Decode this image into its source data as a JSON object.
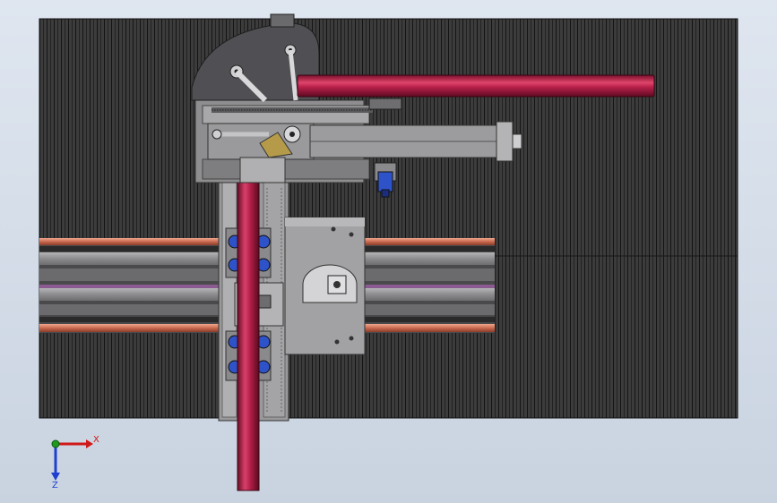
{
  "window": {
    "title": ""
  },
  "colors": {
    "background_top": "#dfe6f0",
    "background_bottom": "#c9d3e0",
    "slat_base": "#3c3c3c",
    "slat_line": "#141414",
    "tube": "#b8204a",
    "tube_highlight": "#ff6f8f",
    "machine_grey": "#8e8e90",
    "rail_copper": "#d27a62",
    "axis_x": "#d01818",
    "axis_y": "#1f9a1f",
    "axis_z": "#1f3fd0",
    "motor_blue": "#2e52c8"
  },
  "triad": {
    "x_label": "X",
    "z_label": "Z",
    "x_icon": "arrow-right-icon",
    "z_icon": "arrow-down-icon",
    "origin_icon": "dot-icon"
  }
}
